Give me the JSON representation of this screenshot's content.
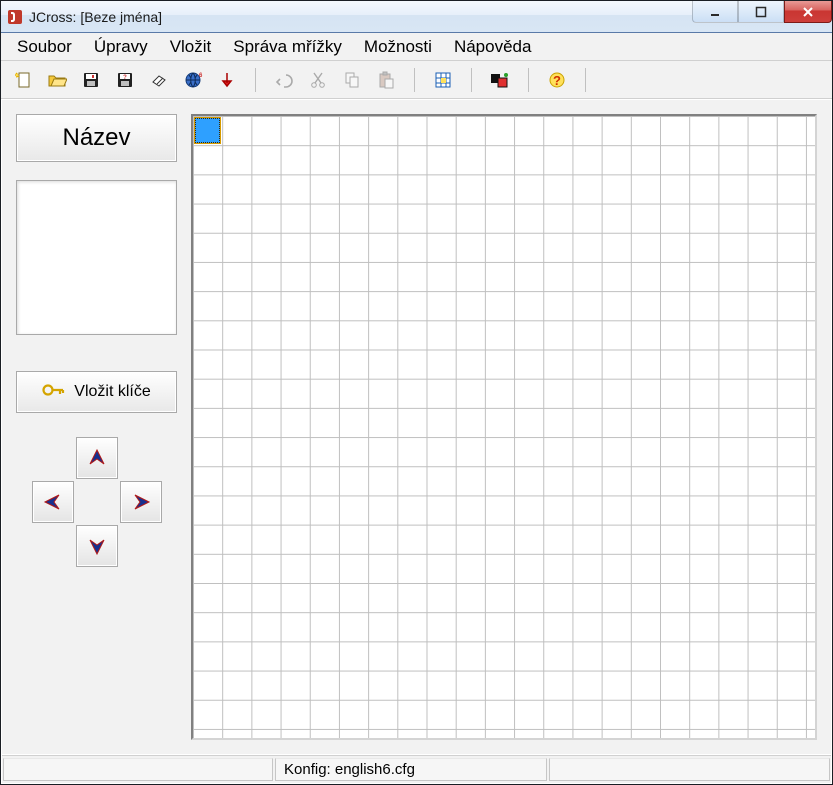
{
  "window": {
    "title": "JCross: [Beze jména]"
  },
  "menu": {
    "items": [
      "Soubor",
      "Úpravy",
      "Vložit",
      "Správa mřížky",
      "Možnosti",
      "Nápověda"
    ]
  },
  "toolbar": {
    "icons": [
      "new-file-icon",
      "open-folder-icon",
      "save-icon",
      "save-as-icon",
      "eraser-icon",
      "web-icon",
      "arrow-down-icon"
    ],
    "edit_icons": [
      "undo-icon",
      "cut-icon",
      "copy-icon",
      "paste-icon"
    ],
    "grid_icon": "grid-tool-icon",
    "color_icon": "color-pair-icon",
    "help_icon": "help-icon"
  },
  "sidebar": {
    "title_button": "Název",
    "keys_button": "Vložit klíče"
  },
  "grid": {
    "rows": 20,
    "cols": 20,
    "selected": {
      "row": 0,
      "col": 0
    }
  },
  "statusbar": {
    "left": "",
    "center": "Konfig: english6.cfg",
    "right": ""
  }
}
